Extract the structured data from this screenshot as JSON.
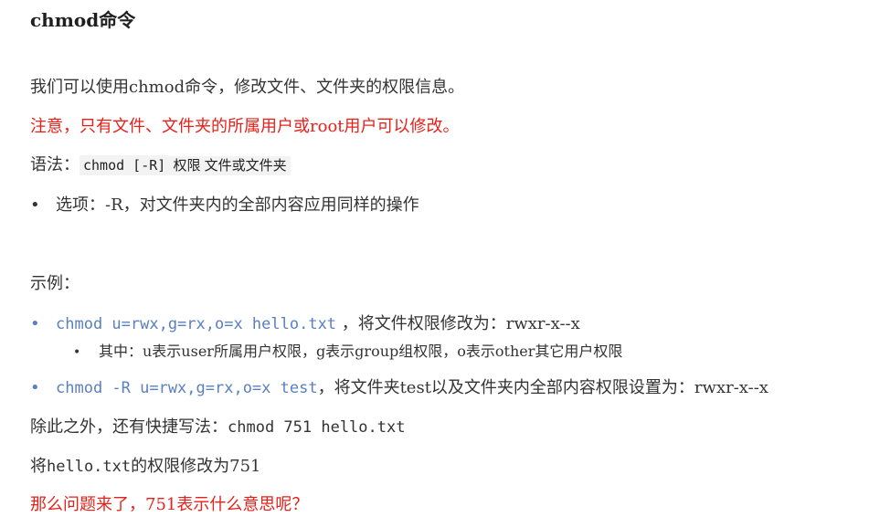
{
  "heading": "chmod命令",
  "intro": "我们可以使用chmod命令，修改文件、文件夹的权限信息。",
  "warning": "注意，只有文件、文件夹的所属用户或root用户可以修改。",
  "syntax": {
    "label": "语法：",
    "code": "chmod [-R]",
    "rest": "权限 文件或文件夹"
  },
  "option": {
    "bullet": "•",
    "text": "选项：-R，对文件夹内的全部内容应用同样的操作"
  },
  "example_label": "示例：",
  "examples": [
    {
      "bullet": "•",
      "code": "chmod u=rwx,g=rx,o=x hello.txt",
      "desc": " ，将文件权限修改为：rwxr-x--x",
      "sub": {
        "bullet": "•",
        "text": "其中：u表示user所属用户权限，g表示group组权限，o表示other其它用户权限"
      }
    },
    {
      "bullet": "•",
      "code": "chmod -R u=rwx,g=rx,o=x test",
      "desc": "，将文件夹test以及文件夹内全部内容权限设置为：rwxr-x--x"
    }
  ],
  "shortcut": {
    "text": "除此之外，还有快捷写法：",
    "code": "chmod 751 hello.txt"
  },
  "change751": {
    "prefix": "将",
    "code": "hello.txt",
    "suffix": "的权限修改为751"
  },
  "question": "那么问题来了，751表示什么意思呢？"
}
